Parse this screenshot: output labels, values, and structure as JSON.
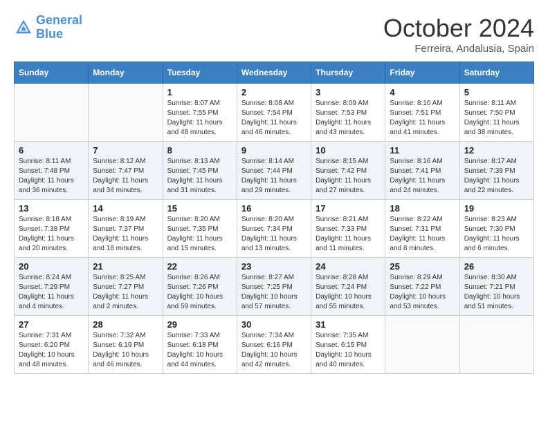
{
  "header": {
    "logo_line1": "General",
    "logo_line2": "Blue",
    "month": "October 2024",
    "location": "Ferreira, Andalusia, Spain"
  },
  "weekdays": [
    "Sunday",
    "Monday",
    "Tuesday",
    "Wednesday",
    "Thursday",
    "Friday",
    "Saturday"
  ],
  "weeks": [
    [
      {
        "day": "",
        "info": ""
      },
      {
        "day": "",
        "info": ""
      },
      {
        "day": "1",
        "info": "Sunrise: 8:07 AM\nSunset: 7:55 PM\nDaylight: 11 hours and 48 minutes."
      },
      {
        "day": "2",
        "info": "Sunrise: 8:08 AM\nSunset: 7:54 PM\nDaylight: 11 hours and 46 minutes."
      },
      {
        "day": "3",
        "info": "Sunrise: 8:09 AM\nSunset: 7:53 PM\nDaylight: 11 hours and 43 minutes."
      },
      {
        "day": "4",
        "info": "Sunrise: 8:10 AM\nSunset: 7:51 PM\nDaylight: 11 hours and 41 minutes."
      },
      {
        "day": "5",
        "info": "Sunrise: 8:11 AM\nSunset: 7:50 PM\nDaylight: 11 hours and 38 minutes."
      }
    ],
    [
      {
        "day": "6",
        "info": "Sunrise: 8:11 AM\nSunset: 7:48 PM\nDaylight: 11 hours and 36 minutes."
      },
      {
        "day": "7",
        "info": "Sunrise: 8:12 AM\nSunset: 7:47 PM\nDaylight: 11 hours and 34 minutes."
      },
      {
        "day": "8",
        "info": "Sunrise: 8:13 AM\nSunset: 7:45 PM\nDaylight: 11 hours and 31 minutes."
      },
      {
        "day": "9",
        "info": "Sunrise: 8:14 AM\nSunset: 7:44 PM\nDaylight: 11 hours and 29 minutes."
      },
      {
        "day": "10",
        "info": "Sunrise: 8:15 AM\nSunset: 7:42 PM\nDaylight: 11 hours and 27 minutes."
      },
      {
        "day": "11",
        "info": "Sunrise: 8:16 AM\nSunset: 7:41 PM\nDaylight: 11 hours and 24 minutes."
      },
      {
        "day": "12",
        "info": "Sunrise: 8:17 AM\nSunset: 7:39 PM\nDaylight: 11 hours and 22 minutes."
      }
    ],
    [
      {
        "day": "13",
        "info": "Sunrise: 8:18 AM\nSunset: 7:38 PM\nDaylight: 11 hours and 20 minutes."
      },
      {
        "day": "14",
        "info": "Sunrise: 8:19 AM\nSunset: 7:37 PM\nDaylight: 11 hours and 18 minutes."
      },
      {
        "day": "15",
        "info": "Sunrise: 8:20 AM\nSunset: 7:35 PM\nDaylight: 11 hours and 15 minutes."
      },
      {
        "day": "16",
        "info": "Sunrise: 8:20 AM\nSunset: 7:34 PM\nDaylight: 11 hours and 13 minutes."
      },
      {
        "day": "17",
        "info": "Sunrise: 8:21 AM\nSunset: 7:33 PM\nDaylight: 11 hours and 11 minutes."
      },
      {
        "day": "18",
        "info": "Sunrise: 8:22 AM\nSunset: 7:31 PM\nDaylight: 11 hours and 8 minutes."
      },
      {
        "day": "19",
        "info": "Sunrise: 8:23 AM\nSunset: 7:30 PM\nDaylight: 11 hours and 6 minutes."
      }
    ],
    [
      {
        "day": "20",
        "info": "Sunrise: 8:24 AM\nSunset: 7:29 PM\nDaylight: 11 hours and 4 minutes."
      },
      {
        "day": "21",
        "info": "Sunrise: 8:25 AM\nSunset: 7:27 PM\nDaylight: 11 hours and 2 minutes."
      },
      {
        "day": "22",
        "info": "Sunrise: 8:26 AM\nSunset: 7:26 PM\nDaylight: 10 hours and 59 minutes."
      },
      {
        "day": "23",
        "info": "Sunrise: 8:27 AM\nSunset: 7:25 PM\nDaylight: 10 hours and 57 minutes."
      },
      {
        "day": "24",
        "info": "Sunrise: 8:28 AM\nSunset: 7:24 PM\nDaylight: 10 hours and 55 minutes."
      },
      {
        "day": "25",
        "info": "Sunrise: 8:29 AM\nSunset: 7:22 PM\nDaylight: 10 hours and 53 minutes."
      },
      {
        "day": "26",
        "info": "Sunrise: 8:30 AM\nSunset: 7:21 PM\nDaylight: 10 hours and 51 minutes."
      }
    ],
    [
      {
        "day": "27",
        "info": "Sunrise: 7:31 AM\nSunset: 6:20 PM\nDaylight: 10 hours and 48 minutes."
      },
      {
        "day": "28",
        "info": "Sunrise: 7:32 AM\nSunset: 6:19 PM\nDaylight: 10 hours and 46 minutes."
      },
      {
        "day": "29",
        "info": "Sunrise: 7:33 AM\nSunset: 6:18 PM\nDaylight: 10 hours and 44 minutes."
      },
      {
        "day": "30",
        "info": "Sunrise: 7:34 AM\nSunset: 6:16 PM\nDaylight: 10 hours and 42 minutes."
      },
      {
        "day": "31",
        "info": "Sunrise: 7:35 AM\nSunset: 6:15 PM\nDaylight: 10 hours and 40 minutes."
      },
      {
        "day": "",
        "info": ""
      },
      {
        "day": "",
        "info": ""
      }
    ]
  ]
}
